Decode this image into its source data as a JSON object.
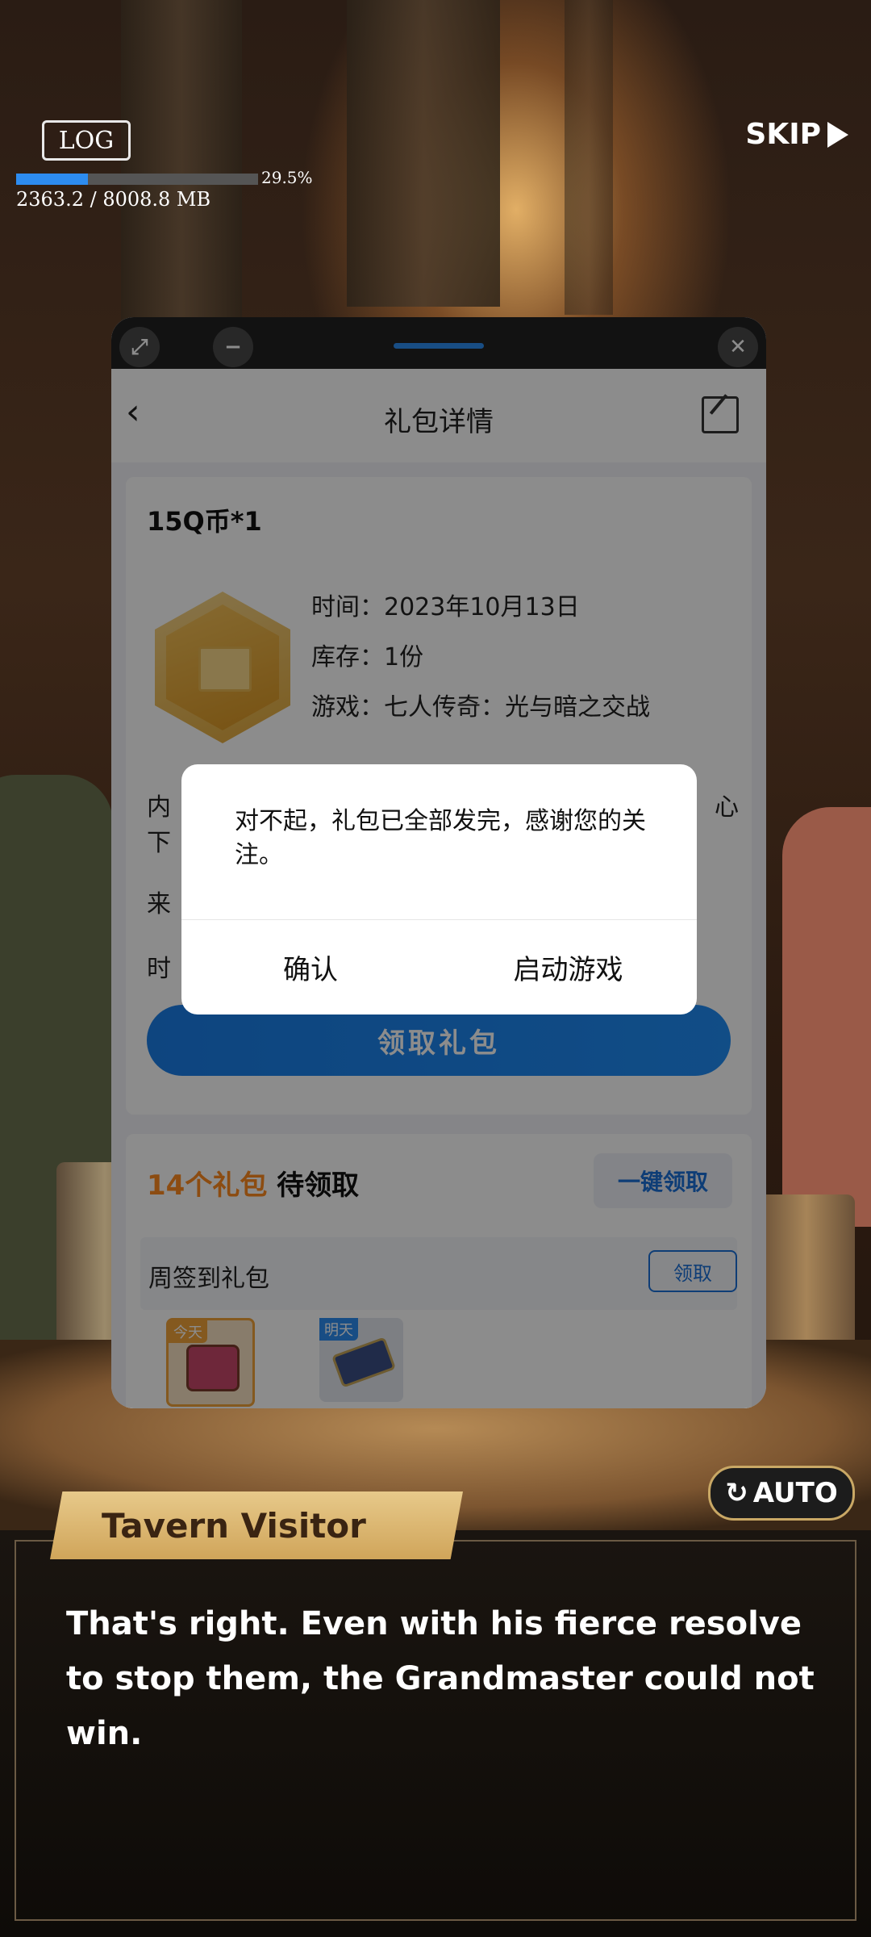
{
  "hud": {
    "log_label": "LOG",
    "download_percent": "29.5%",
    "download_fraction": 0.295,
    "memory_text": "2363.2 / 8008.8 MB",
    "skip_label": "SKIP"
  },
  "floating_window": {
    "page_title": "礼包详情",
    "gift": {
      "name": "15Q币*1",
      "time_label": "时间：",
      "time_value": "2023年10月13日",
      "stock_label": "库存：",
      "stock_value": "1份",
      "game_label": "游戏：",
      "game_value": "七人传奇：光与暗之交战",
      "content_label_partial": "内",
      "content_tail_partial": "心",
      "content_line2_partial": "下",
      "source_label_partial": "来",
      "time2_label_partial": "时",
      "claim_button": "领取礼包"
    },
    "pending": {
      "count_text": "14个礼包",
      "suffix_text": " 待领取",
      "one_click_button": "一键领取",
      "signin_label": "周签到礼包",
      "signin_button": "领取",
      "rewards": [
        {
          "tag": "今天",
          "icon": "treasure-chest-icon"
        },
        {
          "tag": "明天",
          "icon": "ticket-scroll-icon"
        }
      ]
    }
  },
  "dialog": {
    "message": "对不起，礼包已全部发完，感谢您的关注。",
    "confirm_button": "确认",
    "launch_button": "启动游戏"
  },
  "game": {
    "auto_label": "AUTO",
    "speaker": "Tavern Visitor",
    "line": "That's right. Even with his fierce resolve to stop them, the Grandmaster could not win."
  },
  "colors": {
    "accent_blue": "#1f8cf5",
    "highlight_orange": "#ff8a1f",
    "nameplate_gold": "#d0a55a"
  }
}
